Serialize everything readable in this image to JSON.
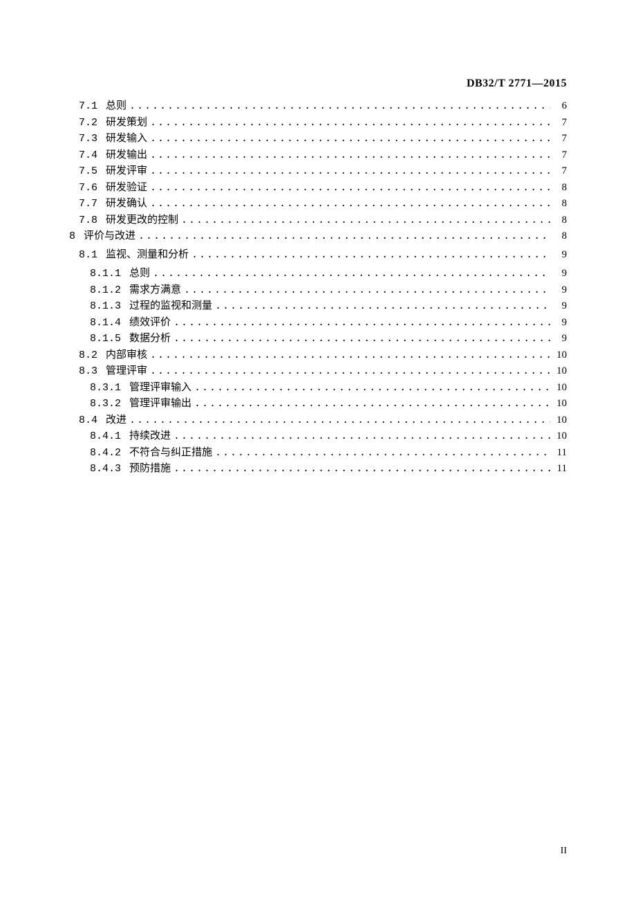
{
  "document_code": "DB32/T 2771—2015",
  "footer_page": "II",
  "toc_entries": [
    {
      "num": "7.1",
      "title": "总则",
      "page": "6",
      "level": 1
    },
    {
      "num": "7.2",
      "title": "研发策划",
      "page": "7",
      "level": 1
    },
    {
      "num": "7.3",
      "title": "研发输入",
      "page": "7",
      "level": 1
    },
    {
      "num": "7.4",
      "title": "研发输出",
      "page": "7",
      "level": 1
    },
    {
      "num": "7.5",
      "title": "研发评审",
      "page": "7",
      "level": 1
    },
    {
      "num": "7.6",
      "title": "研发验证",
      "page": "8",
      "level": 1
    },
    {
      "num": "7.7",
      "title": "研发确认",
      "page": "8",
      "level": 1
    },
    {
      "num": "7.8",
      "title": "研发更改的控制",
      "page": "8",
      "level": 1
    },
    {
      "num": "8",
      "title": "评价与改进",
      "page": "8",
      "level": 0
    },
    {
      "num": "8.1",
      "title": "监视、测量和分析",
      "page": "9",
      "level": 1
    },
    {
      "num": "8.1.1",
      "title": "总则",
      "page": "9",
      "level": 2
    },
    {
      "num": "8.1.2",
      "title": "需求方满意",
      "page": "9",
      "level": 2
    },
    {
      "num": "8.1.3",
      "title": "过程的监视和测量",
      "page": "9",
      "level": 2
    },
    {
      "num": "8.1.4",
      "title": "绩效评价",
      "page": "9",
      "level": 2
    },
    {
      "num": "8.1.5",
      "title": "数据分析",
      "page": "9",
      "level": 2
    },
    {
      "num": "8.2",
      "title": "内部审核",
      "page": "10",
      "level": 1
    },
    {
      "num": "8.3",
      "title": "管理评审",
      "page": "10",
      "level": 1
    },
    {
      "num": "8.3.1",
      "title": "管理评审输入",
      "page": "10",
      "level": 2
    },
    {
      "num": "8.3.2",
      "title": "管理评审输出",
      "page": "10",
      "level": 2
    },
    {
      "num": "8.4",
      "title": "改进",
      "page": "10",
      "level": 1
    },
    {
      "num": "8.4.1",
      "title": "持续改进",
      "page": "10",
      "level": 2
    },
    {
      "num": "8.4.2",
      "title": "不符合与纠正措施",
      "page": "11",
      "level": 2
    },
    {
      "num": "8.4.3",
      "title": "预防措施",
      "page": "11",
      "level": 2
    }
  ]
}
